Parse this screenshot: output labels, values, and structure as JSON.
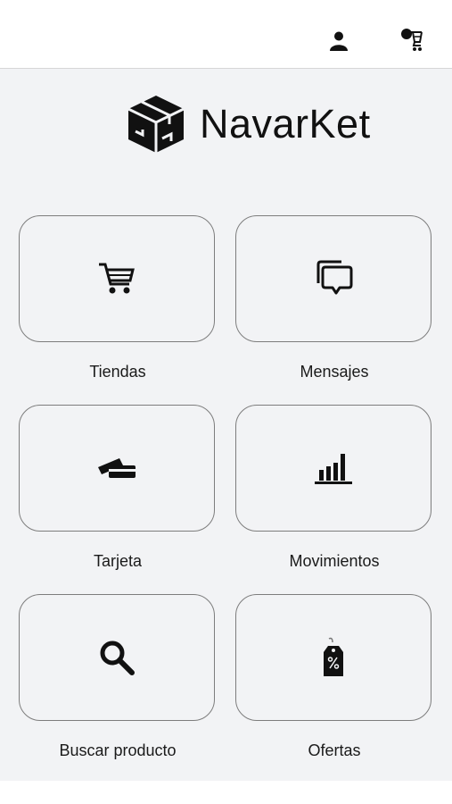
{
  "header": {
    "profile_icon": "user-icon",
    "cart_icon": "cart-icon"
  },
  "brand": {
    "logo_icon": "cube-box-icon",
    "name": "NavarKet"
  },
  "menu": [
    {
      "label": "Tiendas",
      "icon": "shopping-cart-icon"
    },
    {
      "label": "Mensajes",
      "icon": "chat-bubbles-icon"
    },
    {
      "label": "Tarjeta",
      "icon": "cards-icon"
    },
    {
      "label": "Movimientos",
      "icon": "bar-chart-icon"
    },
    {
      "label": "Buscar producto",
      "icon": "magnifier-icon"
    },
    {
      "label": "Ofertas",
      "icon": "price-tag-icon"
    }
  ],
  "colors": {
    "background": "#f2f3f5",
    "tile_border": "#7d7d7d",
    "text": "#1a1a1a"
  }
}
